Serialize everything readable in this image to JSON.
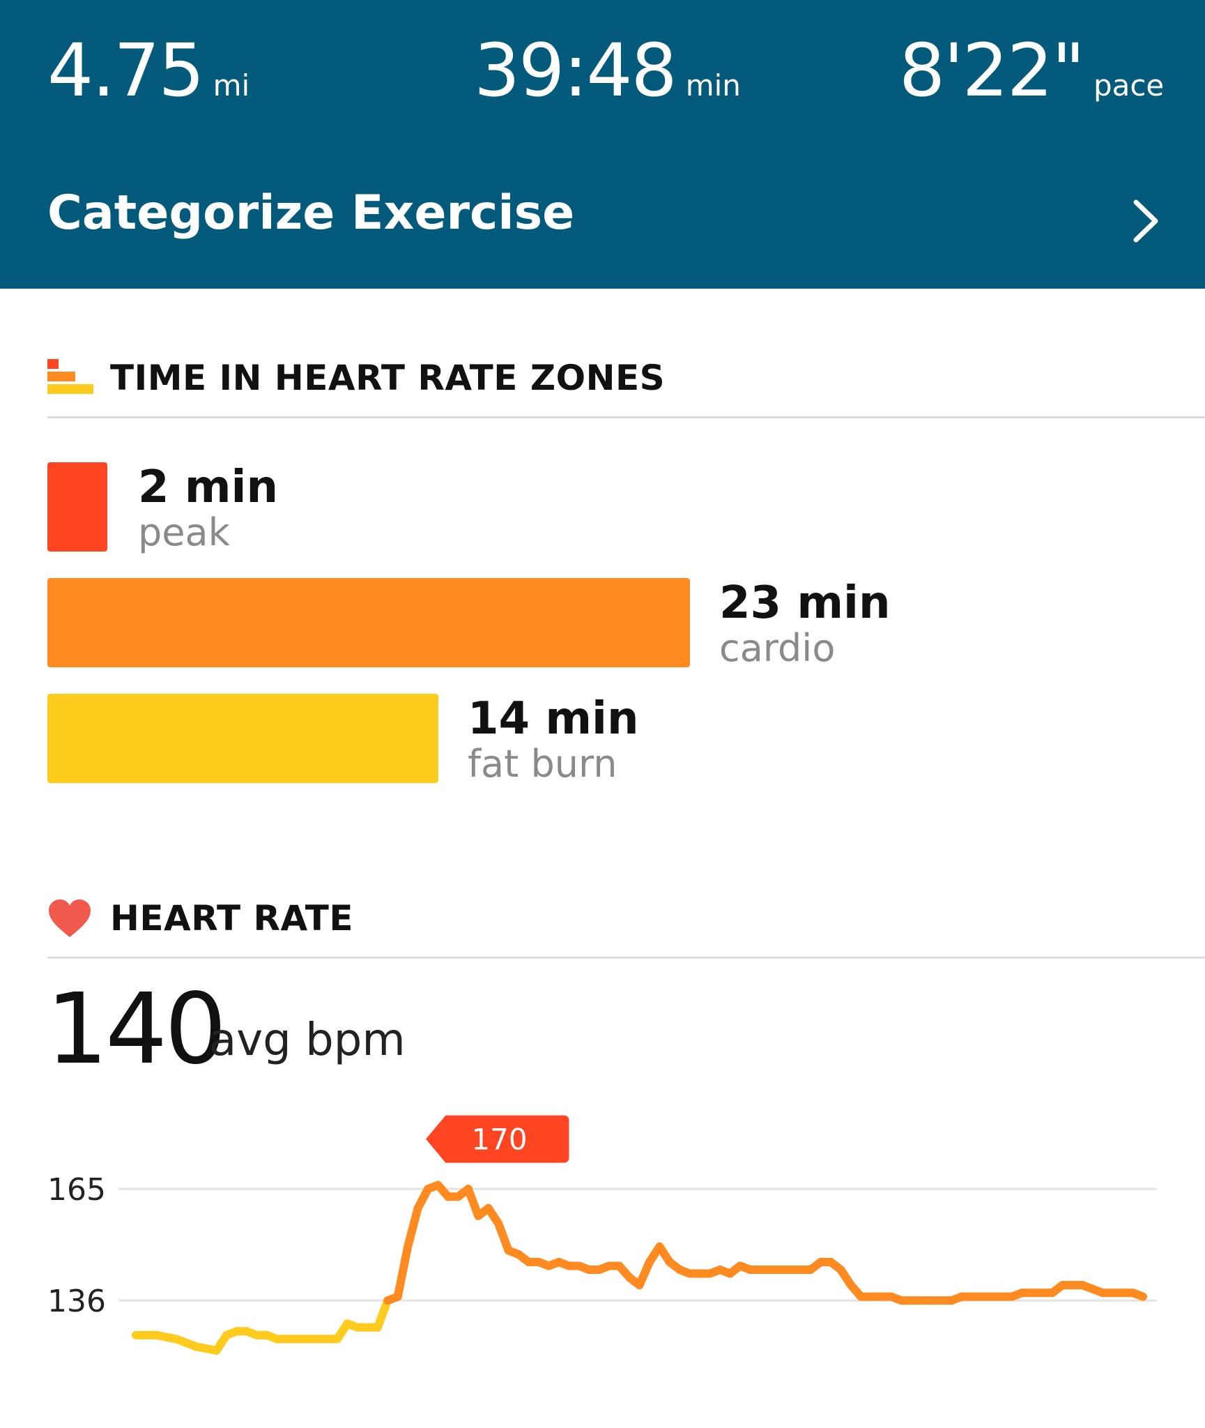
{
  "summary": {
    "distance": {
      "value": "4.75",
      "unit": "mi"
    },
    "duration": {
      "value": "39:48",
      "unit": "min"
    },
    "pace": {
      "value": "8'22\"",
      "unit": "pace"
    }
  },
  "categorize": {
    "label": "Categorize Exercise"
  },
  "zones_section": {
    "title": "TIME IN HEART RATE ZONES"
  },
  "zones": [
    {
      "value": "2 min",
      "label": "peak",
      "minutes": 2,
      "color": "#ff4422"
    },
    {
      "value": "23 min",
      "label": "cardio",
      "minutes": 23,
      "color": "#ff8a1f"
    },
    {
      "value": "14 min",
      "label": "fat burn",
      "minutes": 14,
      "color": "#ffcc1e"
    }
  ],
  "heart_section": {
    "title": "HEART RATE"
  },
  "avg": {
    "value": "140",
    "unit": "avg bpm"
  },
  "chart_data": {
    "type": "line",
    "ytick_labels": [
      "165",
      "136"
    ],
    "yticks": [
      165,
      136
    ],
    "ylim": [
      117,
      175
    ],
    "peak_label": "170",
    "x": [
      0,
      2,
      4,
      6,
      8,
      9,
      10,
      11,
      12,
      13,
      14,
      15,
      16,
      17,
      18,
      19,
      20,
      21,
      22,
      23,
      24,
      25,
      26,
      27,
      28,
      29,
      30,
      31,
      32,
      33,
      34,
      35,
      36,
      37,
      38,
      39,
      40,
      41,
      42,
      43,
      44,
      45,
      46,
      47,
      48,
      49,
      50,
      51,
      52,
      53,
      54,
      55,
      56,
      57,
      58,
      59,
      60,
      61,
      62,
      63,
      64,
      65,
      66,
      67,
      68,
      69,
      70,
      71,
      72,
      73,
      74,
      75,
      76,
      77,
      78,
      79,
      80,
      81,
      82,
      83,
      84,
      85,
      86,
      87,
      88,
      89,
      90,
      91,
      92,
      93,
      94,
      95,
      96,
      97,
      98,
      99,
      100
    ],
    "y": [
      127,
      127,
      126,
      124,
      123,
      127,
      128,
      128,
      127,
      127,
      126,
      126,
      126,
      126,
      126,
      126,
      126,
      130,
      129,
      129,
      129,
      136,
      137,
      150,
      160,
      165,
      166,
      163,
      163,
      165,
      158,
      160,
      156,
      149,
      148,
      146,
      146,
      145,
      146,
      145,
      145,
      144,
      144,
      145,
      145,
      142,
      140,
      146,
      150,
      146,
      144,
      143,
      143,
      143,
      144,
      143,
      145,
      144,
      144,
      144,
      144,
      144,
      144,
      144,
      146,
      146,
      144,
      140,
      137,
      137,
      137,
      137,
      136,
      136,
      136,
      136,
      136,
      136,
      137,
      137,
      137,
      137,
      137,
      137,
      138,
      138,
      138,
      138,
      140,
      140,
      140,
      139,
      138,
      138,
      138,
      138,
      137
    ],
    "segment_colors": {
      "fat_burn": "#ffcc1e",
      "cardio": "#ff8a1f",
      "peak": "#ff4422"
    },
    "colors": {
      "grid": "#e2e2e2",
      "tag": "#ff4422"
    }
  },
  "colors": {
    "header": "#035a7b",
    "heart_icon": "#f25a4e"
  }
}
